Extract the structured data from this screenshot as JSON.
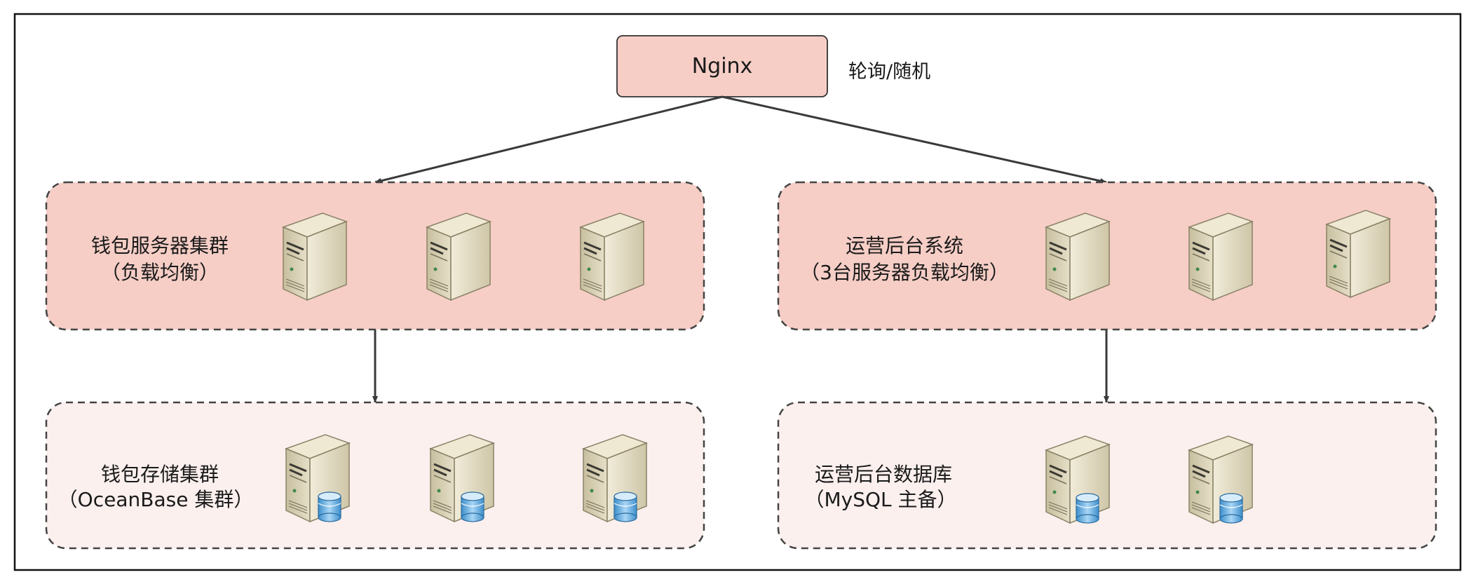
{
  "colors": {
    "frame_border": "#111111",
    "nginx_fill": "#f6cec6",
    "cluster_fill": "#f6cec6",
    "storage_fill": "#fbf0ee",
    "dashed_border": "#444444",
    "arrow": "#3a3a3a",
    "server_body": "#d9d2ba",
    "db_cylinder": "#5aa7dd"
  },
  "nginx": {
    "label": "Nginx",
    "note": "轮询/随机"
  },
  "clusters": [
    {
      "id": "wallet-service",
      "lines": [
        "钱包服务器集群",
        "（负载均衡）"
      ],
      "server_count": 3,
      "icon": "server-icon"
    },
    {
      "id": "ops-backend",
      "lines": [
        "运营后台系统",
        "（3台服务器负载均衡）"
      ],
      "server_count": 3,
      "icon": "server-icon"
    },
    {
      "id": "wallet-storage",
      "lines": [
        "钱包存储集群",
        "（OceanBase 集群）"
      ],
      "server_count": 3,
      "icon": "database-server-icon"
    },
    {
      "id": "ops-database",
      "lines": [
        "运营后台数据库",
        "（MySQL 主备）"
      ],
      "server_count": 2,
      "icon": "database-server-icon"
    }
  ]
}
